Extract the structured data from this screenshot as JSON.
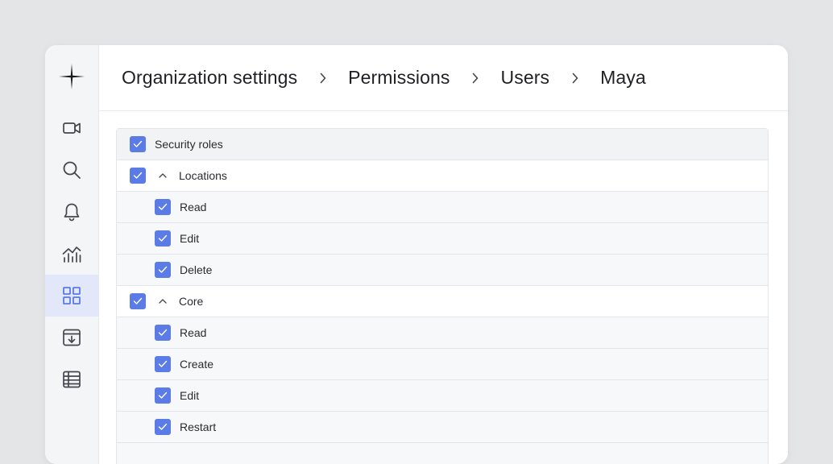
{
  "breadcrumb": {
    "items": [
      "Organization settings",
      "Permissions",
      "Users",
      "Maya"
    ]
  },
  "sidebar": {
    "items": [
      {
        "icon": "video-icon",
        "active": false
      },
      {
        "icon": "search-icon",
        "active": false
      },
      {
        "icon": "bell-icon",
        "active": false
      },
      {
        "icon": "analytics-icon",
        "active": false
      },
      {
        "icon": "grid-icon",
        "active": true
      },
      {
        "icon": "archive-download-icon",
        "active": false
      },
      {
        "icon": "table-icon",
        "active": false
      }
    ]
  },
  "permissions": {
    "header": {
      "label": "Security roles",
      "checked": true
    },
    "groups": [
      {
        "label": "Locations",
        "checked": true,
        "expanded": true,
        "children": [
          {
            "label": "Read",
            "checked": true
          },
          {
            "label": "Edit",
            "checked": true
          },
          {
            "label": "Delete",
            "checked": true
          }
        ]
      },
      {
        "label": "Core",
        "checked": true,
        "expanded": true,
        "children": [
          {
            "label": "Read",
            "checked": true
          },
          {
            "label": "Create",
            "checked": true
          },
          {
            "label": "Edit",
            "checked": true
          },
          {
            "label": "Restart",
            "checked": true
          }
        ]
      }
    ]
  },
  "colors": {
    "accent": "#5b7be6",
    "active_nav": "#e3e7fa",
    "background": "#e4e5e7"
  }
}
